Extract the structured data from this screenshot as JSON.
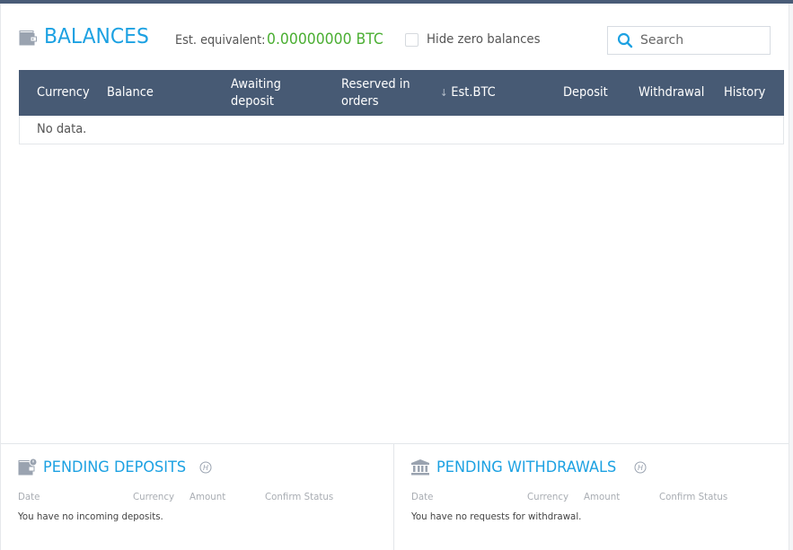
{
  "header": {
    "title": "BALANCES",
    "est_label": "Est. equivalent:",
    "est_value": "0.00000000 BTC",
    "hide_zero_label": "Hide zero balances",
    "hide_zero_checked": false,
    "search_placeholder": "Search",
    "search_value": ""
  },
  "table": {
    "columns": [
      {
        "label": "Currency"
      },
      {
        "label": "Balance"
      },
      {
        "label": "Awaiting",
        "label2": "deposit"
      },
      {
        "label": "Reserved in",
        "label2": "orders"
      },
      {
        "label": "Est.BTC",
        "sort": "desc",
        "sort_icon": "↓"
      },
      {
        "label": "Deposit"
      },
      {
        "label": "Withdrawal"
      },
      {
        "label": "History"
      }
    ],
    "rows": [],
    "empty_text": "No data."
  },
  "pending_deposits": {
    "title": "PENDING DEPOSITS",
    "help_icon": "Ⓗ",
    "columns": [
      "Date",
      "Currency",
      "Amount",
      "Confirm Status"
    ],
    "empty_text": "You have no incoming deposits."
  },
  "pending_withdrawals": {
    "title": "PENDING WITHDRAWALS",
    "help_icon": "Ⓗ",
    "columns": [
      "Date",
      "Currency",
      "Amount",
      "Confirm Status"
    ],
    "empty_text": "You have no requests for withdrawal."
  },
  "colors": {
    "accent": "#1ca1e2",
    "header_bg": "#475a74",
    "positive": "#4caf34",
    "icon_gray": "#9aa3b0"
  }
}
